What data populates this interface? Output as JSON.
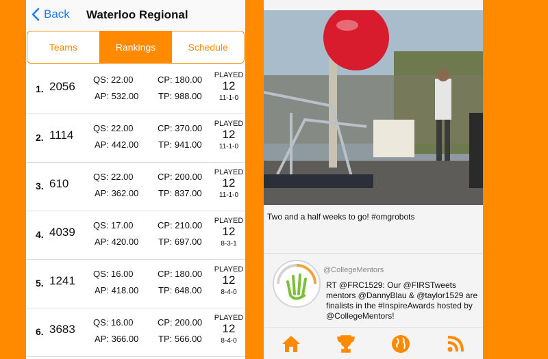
{
  "left": {
    "back_label": "Back",
    "title": "Waterloo Regional",
    "tabs": [
      "Teams",
      "Rankings",
      "Schedule"
    ],
    "rows": [
      {
        "rank": "1.",
        "team": "2056",
        "qs": "QS: 22.00",
        "ap": "AP: 532.00",
        "cp": "CP:  180.00",
        "tp": "TP:  988.00",
        "played_label": "PLAYED",
        "played": "12",
        "record": "11-1-0"
      },
      {
        "rank": "2.",
        "team": "1114",
        "qs": "QS: 22.00",
        "ap": "AP: 442.00",
        "cp": "CP:  370.00",
        "tp": "TP:  941.00",
        "played_label": "PLAYED",
        "played": "12",
        "record": "11-1-0"
      },
      {
        "rank": "3.",
        "team": "610",
        "qs": "QS: 22.00",
        "ap": "AP: 362.00",
        "cp": "CP:  200.00",
        "tp": "TP:  837.00",
        "played_label": "PLAYED",
        "played": "12",
        "record": "11-1-0"
      },
      {
        "rank": "4.",
        "team": "4039",
        "qs": "QS: 17.00",
        "ap": "AP: 420.00",
        "cp": "CP:  210.00",
        "tp": "TP:  697.00",
        "played_label": "PLAYED",
        "played": "12",
        "record": "8-3-1"
      },
      {
        "rank": "5.",
        "team": "1241",
        "qs": "QS: 16.00",
        "ap": "AP: 418.00",
        "cp": "CP:  180.00",
        "tp": "TP:  648.00",
        "played_label": "PLAYED",
        "played": "12",
        "record": "8-4-0"
      },
      {
        "rank": "6.",
        "team": "3683",
        "qs": "QS: 16.00",
        "ap": "AP: 366.00",
        "cp": "CP:  200.00",
        "tp": "TP:  566.00",
        "played_label": "PLAYED",
        "played": "12",
        "record": "8-4-0"
      }
    ]
  },
  "right": {
    "caption": "Two and a half weeks to go! #omgrobots",
    "tweet_handle": "@CollegeMentors",
    "tweet_text": "RT @FRC1529: Our @FIRSTweets mentors @DannyBlau & @taylor1529 are finalists in the #InspireAwards hosted by @CollegeMentors!",
    "tabbar_icons": [
      "home-icon",
      "trophy-icon",
      "globe-icon",
      "rss-icon"
    ]
  },
  "colors": {
    "accent": "#ff8a00",
    "link": "#1a7ef2"
  }
}
